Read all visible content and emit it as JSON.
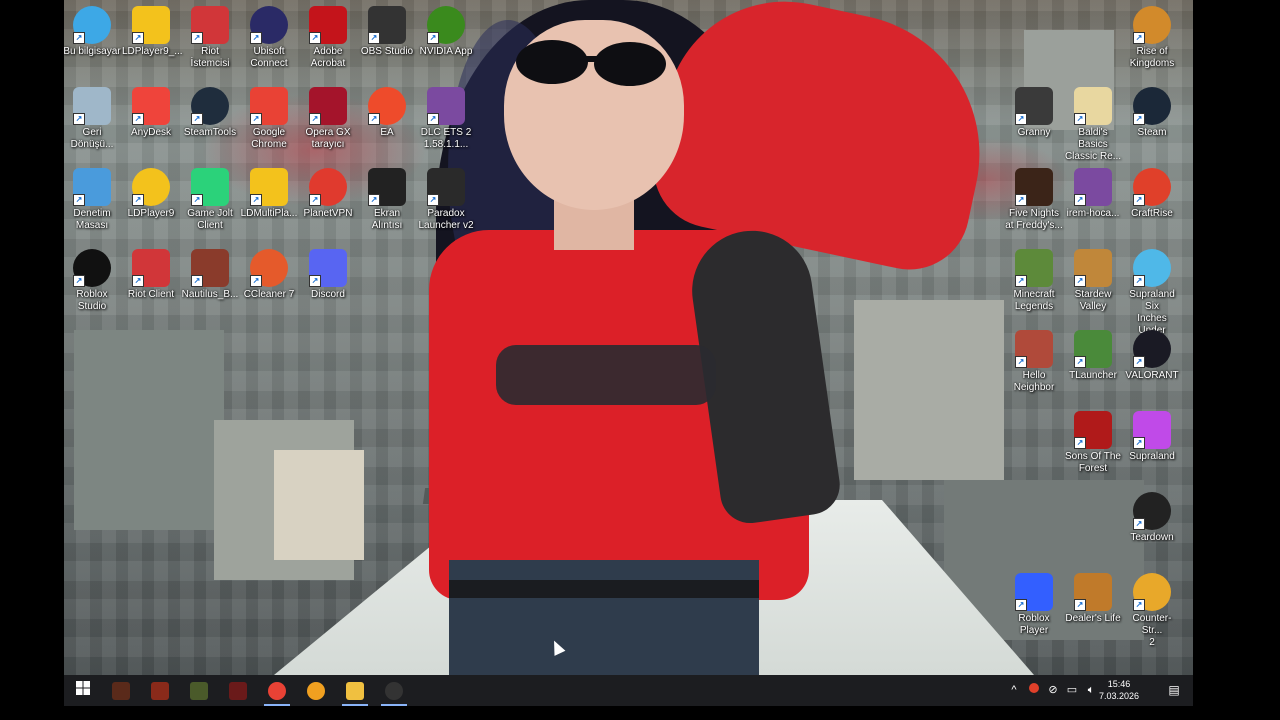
{
  "desktop": {
    "icons_left": [
      {
        "name": "bu-bilgisayar",
        "label": "Bu bilgisayar",
        "color": "#3da8e6"
      },
      {
        "name": "ldplayer9-a",
        "label": "LDPlayer9_...",
        "color": "#f3c21c"
      },
      {
        "name": "riot-istemcisi",
        "label": "Riot İstemcisi",
        "color": "#d13639"
      },
      {
        "name": "ubisoft-connect",
        "label": "Ubisoft\nConnect",
        "color": "#2a2a66"
      },
      {
        "name": "adobe-acrobat",
        "label": "Adobe\nAcrobat",
        "color": "#c4141b"
      },
      {
        "name": "obs-studio",
        "label": "OBS Studio",
        "color": "#333333"
      },
      {
        "name": "nvidia-app",
        "label": "NVIDIA App",
        "color": "#3a8a1d"
      },
      {
        "name": "geri-donusum",
        "label": "Geri\nDönüşü...",
        "color": "#9fb7c9"
      },
      {
        "name": "anydesk",
        "label": "AnyDesk",
        "color": "#ef443b"
      },
      {
        "name": "steamtools",
        "label": "SteamTools",
        "color": "#1f2d3d"
      },
      {
        "name": "google-chrome",
        "label": "Google\nChrome",
        "color": "#e94235"
      },
      {
        "name": "opera-gx",
        "label": "Opera GX\ntarayıcı",
        "color": "#a4142b"
      },
      {
        "name": "ea",
        "label": "EA",
        "color": "#ee4b2b"
      },
      {
        "name": "dlc-ets2",
        "label": "DLC ETS 2\n1.58.1.1...",
        "color": "#7b4aa0"
      },
      {
        "name": "denetim-masasi",
        "label": "Denetim\nMasası",
        "color": "#4a9bdc"
      },
      {
        "name": "ldplayer9-b",
        "label": "LDPlayer9",
        "color": "#f3c21c"
      },
      {
        "name": "gamejolt-client",
        "label": "Game Jolt\nClient",
        "color": "#2bd27a"
      },
      {
        "name": "ldmultiplayer",
        "label": "LDMultiPla...",
        "color": "#f3c21c"
      },
      {
        "name": "planetvpn",
        "label": "PlanetVPN",
        "color": "#e03a2e"
      },
      {
        "name": "ekran-alintisi",
        "label": "Ekran Alıntısı",
        "color": "#222222"
      },
      {
        "name": "paradox-launcher",
        "label": "Paradox\nLauncher v2",
        "color": "#2a2a2a"
      },
      {
        "name": "roblox-studio",
        "label": "Roblox\nStudio",
        "color": "#111111"
      },
      {
        "name": "riot-client",
        "label": "Riot Client",
        "color": "#d13639"
      },
      {
        "name": "nautilus",
        "label": "Nautilus_B...",
        "color": "#8a3b2b"
      },
      {
        "name": "ccleaner",
        "label": "CCleaner 7",
        "color": "#e55a2b"
      },
      {
        "name": "discord",
        "label": "Discord",
        "color": "#5865f2"
      }
    ],
    "icons_right": [
      {
        "name": "rise-of-kingdoms",
        "label": "Rise of\nKingdoms",
        "color": "#d28a2b"
      },
      {
        "name": "granny",
        "label": "Granny",
        "color": "#3a3a3a"
      },
      {
        "name": "baldis-basics",
        "label": "Baldi's Basics\nClassic Re...",
        "color": "#e8d7a0"
      },
      {
        "name": "steam",
        "label": "Steam",
        "color": "#1b2838"
      },
      {
        "name": "five-nights",
        "label": "Five Nights\nat Freddy's...",
        "color": "#3b2418"
      },
      {
        "name": "irem-hoca",
        "label": "irem-hoca...",
        "color": "#7b4aa0"
      },
      {
        "name": "craftrise",
        "label": "CraftRise",
        "color": "#e0402a"
      },
      {
        "name": "minecraft-legends",
        "label": "Minecraft\nLegends",
        "color": "#5d8a3a"
      },
      {
        "name": "stardew-valley",
        "label": "Stardew\nValley",
        "color": "#c0873a"
      },
      {
        "name": "supraland-six",
        "label": "Supraland Six\nInches Under",
        "color": "#4fb8e8"
      },
      {
        "name": "hello-neighbor",
        "label": "Hello\nNeighbor",
        "color": "#b04a3a"
      },
      {
        "name": "tlauncher",
        "label": "TLauncher",
        "color": "#4a8a3a"
      },
      {
        "name": "valorant",
        "label": "VALORANT",
        "color": "#1a1a24"
      },
      {
        "name": "sons-of-the-forest",
        "label": "Sons Of The\nForest",
        "color": "#b01a1a"
      },
      {
        "name": "supraland",
        "label": "Supraland",
        "color": "#c04ae8"
      },
      {
        "name": "teardown",
        "label": "Teardown",
        "color": "#222222"
      },
      {
        "name": "roblox-player",
        "label": "Roblox\nPlayer",
        "color": "#335fff"
      },
      {
        "name": "dealers-life",
        "label": "Dealer's Life",
        "color": "#c07a2a"
      },
      {
        "name": "counter-strike",
        "label": "Counter-Str...\n2",
        "color": "#e8a82a"
      }
    ]
  },
  "taskbar": {
    "apps": [
      {
        "name": "start-button",
        "icon": "windows-icon"
      },
      {
        "name": "taskbar-app-1",
        "color": "#5a2a1a"
      },
      {
        "name": "taskbar-app-2",
        "color": "#8a2a1a"
      },
      {
        "name": "taskbar-app-3",
        "color": "#4a5a2a"
      },
      {
        "name": "taskbar-app-4",
        "color": "#6a1a1a"
      },
      {
        "name": "taskbar-chrome",
        "color": "#e94235"
      },
      {
        "name": "taskbar-opera",
        "color": "#f0a020"
      },
      {
        "name": "taskbar-explorer",
        "color": "#f0c040"
      },
      {
        "name": "taskbar-obs",
        "color": "#333333"
      }
    ],
    "clock": {
      "time": "15:46",
      "date": "7.03.2026"
    }
  }
}
